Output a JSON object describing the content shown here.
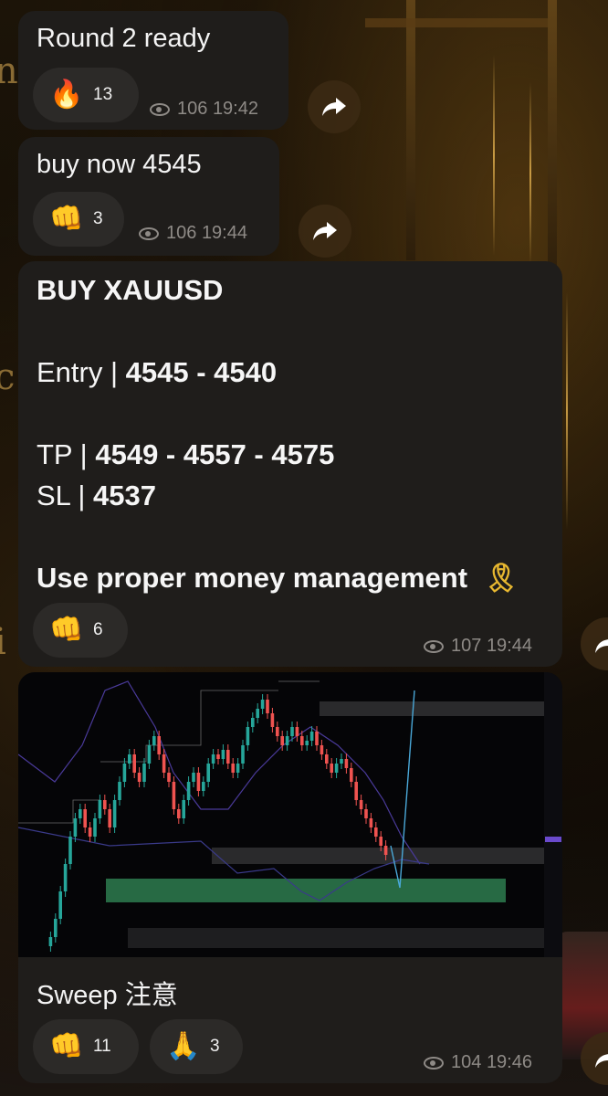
{
  "messages": [
    {
      "text": "Round 2 ready",
      "reactions": [
        {
          "emoji": "🔥",
          "icon": "fire-icon",
          "count": "13"
        }
      ],
      "views": "106",
      "time": "19:42"
    },
    {
      "text": "buy now 4545",
      "reactions": [
        {
          "emoji": "👊",
          "icon": "fist-icon",
          "count": "3"
        }
      ],
      "views": "106",
      "time": "19:44"
    },
    {
      "title": "BUY XAUUSD",
      "entry_label": "Entry | ",
      "entry_value": "4545 - 4540",
      "tp_label": "TP | ",
      "tp_value": "4549 - 4557 - 4575",
      "sl_label": "SL | ",
      "sl_value": "4537",
      "note": "Use proper money management",
      "note_emoji": "🎗",
      "reactions": [
        {
          "emoji": "👊",
          "icon": "fist-icon",
          "count": "6"
        }
      ],
      "views": "107",
      "time": "19:44"
    },
    {
      "caption": "Sweep 注意",
      "reactions": [
        {
          "emoji": "👊",
          "icon": "fist-icon",
          "count": "11"
        },
        {
          "emoji": "🙏",
          "icon": "pray-icon",
          "count": "3"
        }
      ],
      "views": "104",
      "time": "19:46"
    }
  ],
  "colors": {
    "bubble": "#1f1d1b",
    "reaction_bg": "#2c2a28",
    "meta_text": "#8e8a86",
    "bull_candle": "#26a69a",
    "bear_candle": "#ef5350",
    "zone_green": "#2e7d4f"
  }
}
